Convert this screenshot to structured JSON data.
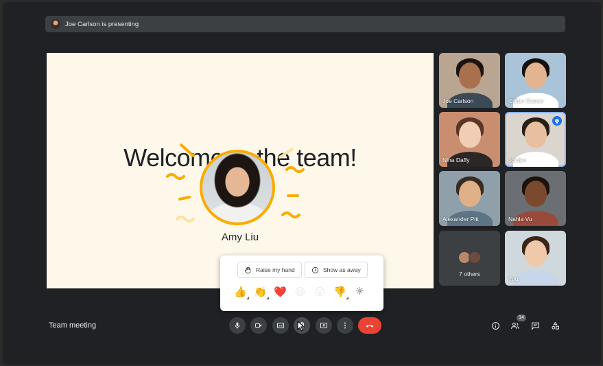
{
  "banner": {
    "text": "Joe Carlson is presenting"
  },
  "slide": {
    "title": "Welcome to the team!",
    "presenter_name": "Amy Liu"
  },
  "participants": [
    {
      "name": "Joe Carlson",
      "skin": "#a8704c",
      "hair": "#1a1412",
      "bg": "#b9a591",
      "shirt": "#3b4a57"
    },
    {
      "name": "Cillian Garner",
      "skin": "#e2b48f",
      "hair": "#16110e",
      "bg": "#a9c4d8",
      "shirt": "#ffffff"
    },
    {
      "name": "Nina Daffy",
      "skin": "#f1cdb5",
      "hair": "#5a3626",
      "bg": "#c98e6f",
      "shirt": "#2b2726"
    },
    {
      "name": "Jordan",
      "skin": "#e8c0a0",
      "hair": "#2b1e17",
      "bg": "#dad5cf",
      "shirt": "#ffffff",
      "active": true
    },
    {
      "name": "Alexander Pitt",
      "skin": "#e0b089",
      "hair": "#3a2b22",
      "bg": "#8fa0aa",
      "shirt": "#5d7487"
    },
    {
      "name": "Nahla Vu",
      "skin": "#7b4a2e",
      "hair": "#1c120c",
      "bg": "#6b6f74",
      "shirt": "#9a4a3b"
    }
  ],
  "others": {
    "label": "7 others",
    "avatar_colors": [
      "#b98a6a",
      "#6d4c3b"
    ]
  },
  "self_tile": {
    "name": "You",
    "skin": "#f0c8aa",
    "hair": "#3b2418",
    "bg": "#cfd8dc",
    "shirt": "#c7d6e8"
  },
  "reactions_popup": {
    "raise_hand_label": "Raise my hand",
    "show_away_label": "Show as away",
    "emojis": [
      {
        "glyph": "👍",
        "tone": true
      },
      {
        "glyph": "👏",
        "tone": true
      },
      {
        "glyph": "❤️",
        "tone": false
      },
      {
        "glyph": "😆",
        "tone": false
      },
      {
        "glyph": "😮",
        "tone": false
      },
      {
        "glyph": "👎",
        "tone": true
      }
    ]
  },
  "bottom_bar": {
    "meeting_name": "Team meeting",
    "people_count": "14"
  },
  "colors": {
    "accent_yellow": "#f9ab00",
    "end_call_red": "#ea4335",
    "active_blue": "#8ab4f8",
    "slide_bg": "#fdf8ea"
  }
}
